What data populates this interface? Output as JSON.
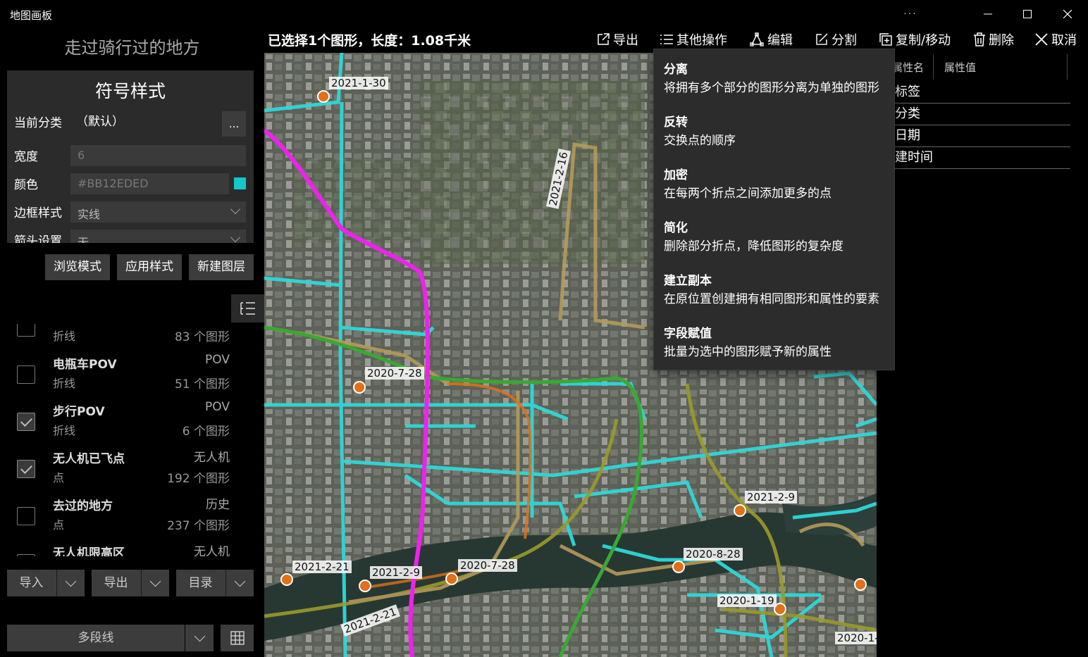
{
  "window": {
    "title": "地图画板",
    "more": "···",
    "minimize": "—",
    "maximize": "☐",
    "close": "✕"
  },
  "left": {
    "layer_title": "走过骑行过的地方",
    "symbol": {
      "title": "符号样式",
      "current_category_label": "当前分类",
      "current_category_value": "（默认）",
      "more_button": "...",
      "width_label": "宽度",
      "width_value": "6",
      "color_label": "颜色",
      "color_value": "#BB12EDED",
      "border_label": "边框样式",
      "border_value": "实线",
      "arrow_label": "箭头设置",
      "arrow_value": "无"
    },
    "buttons": {
      "browse": "浏览模式",
      "apply": "应用样式",
      "new_layer": "新建图层"
    },
    "layers": [
      {
        "name": "",
        "type": "折线",
        "group": "",
        "count": "83 个图形",
        "checked": false
      },
      {
        "name": "电瓶车POV",
        "type": "折线",
        "group": "POV",
        "count": "51 个图形",
        "checked": false
      },
      {
        "name": "步行POV",
        "type": "折线",
        "group": "POV",
        "count": "6 个图形",
        "checked": true
      },
      {
        "name": "无人机已飞点",
        "type": "点",
        "group": "无人机",
        "count": "192 个图形",
        "checked": true
      },
      {
        "name": "去过的地方",
        "type": "点",
        "group": "历史",
        "count": "237 个图形",
        "checked": false
      },
      {
        "name": "无人机限高区",
        "type": "",
        "group": "无人机",
        "count": "",
        "checked": false
      }
    ],
    "bottom": {
      "import": "导入",
      "export": "导出",
      "catalog": "目录",
      "geometry_type": "多段线"
    }
  },
  "toolbar": {
    "selection_info": "已选择1个图形，长度：1.08千米",
    "export": "导出",
    "other_ops": "其他操作",
    "edit": "编辑",
    "split": "分割",
    "copy_move": "复制/移动",
    "delete": "删除",
    "cancel": "取消"
  },
  "attributes": {
    "header_name": "属性名",
    "header_value": "属性值",
    "rows": [
      "标签",
      "分类",
      "日期",
      "建时间"
    ]
  },
  "menu": [
    {
      "title": "分离",
      "desc": "将拥有多个部分的图形分离为单独的图形"
    },
    {
      "title": "反转",
      "desc": "交换点的顺序"
    },
    {
      "title": "加密",
      "desc": "在每两个折点之间添加更多的点"
    },
    {
      "title": "简化",
      "desc": "删除部分折点，降低图形的复杂度"
    },
    {
      "title": "建立副本",
      "desc": "在原位置创建拥有相同图形和属性的要素"
    },
    {
      "title": "字段赋值",
      "desc": "批量为选中的图形赋予新的属性"
    }
  ],
  "map": {
    "labels": [
      "2021-1-30",
      "2021-2-16",
      "2020-7-28",
      "2021-2-9",
      "2020-8-28",
      "2021-2-21",
      "2021-2-9",
      "2020-7-28",
      "2020-1-19",
      "2021-2-21",
      "2020-1-"
    ],
    "colors": {
      "cyan": "#2fd8d8",
      "magenta": "#ee22ee",
      "green": "#3aa832",
      "olive": "#9a9a2a",
      "tan": "#b59a5a",
      "orange": "#e0701a"
    }
  }
}
